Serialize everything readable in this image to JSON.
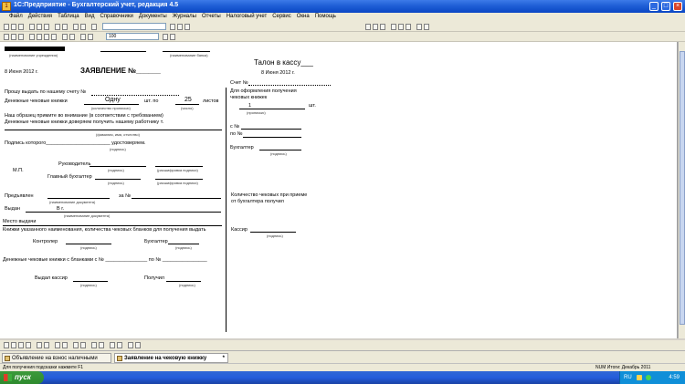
{
  "window": {
    "title": "1С:Предприятие - Бухгалтерский учет, редакция 4.5"
  },
  "menu": [
    "Файл",
    "Действия",
    "Таблица",
    "Вид",
    "Справочники",
    "Документы",
    "Журналы",
    "Отчеты",
    "Налоговый учет",
    "Сервис",
    "Окна",
    "Помощь"
  ],
  "toolbar": {
    "zoom_value": "100"
  },
  "form": {
    "bank_caption": "(наименование учреждения)",
    "bank_caption2": "(наименование банка)",
    "date": "8 Июня 2012 г.",
    "title": "ЗАЯВЛЕНИЕ №______",
    "line1": "Прошу выдать по нашему счету №",
    "line2_label": "Денежные чековые книжки",
    "line2_count": "Одну",
    "line2_unit": "шт. по",
    "line2_sheets": "25",
    "line2_end": "листов",
    "cap_count": "(количество прописью)",
    "cap_sheets": "(число)",
    "line3": "Наш образец примите во внимание (в соответствии с требованием)",
    "line4": "Денежные чековые книжки доверяем получить нашему работнику т.",
    "cap_name": "(фамилия, имя, отчество)",
    "line5": "Подпись которого_______________________ удостоверяем.",
    "cap_sign": "(подпись)",
    "mp": "М.П.",
    "head": "Руководитель",
    "chief_acc": "Главный бухгалтер",
    "cap_sign2": "(подпись)",
    "cap_decode": "(расшифровка подписи)",
    "presented": "Предъявлен",
    "cap_doc": "(наименование документа)",
    "doc_num": "за №",
    "issued": "Выдан",
    "issued_year": "В г.",
    "cap_issuer": "(наименование документа)",
    "residence": "Место выдачи",
    "note": "Книжки указанного наименования, количества чековых бланков для получения выдать",
    "controller": "Контролер",
    "accountant": "Бухгалтер",
    "cheque_books": "Денежные чековые книжки с бланками с № _______________ по № ________________",
    "cashier": "Выдал кассир",
    "received": "Получил",
    "cap_sign3": "(подпись)"
  },
  "stub": {
    "title": "Талон в кассу___",
    "date": "8 Июня 2012 г.",
    "account": "Счет №",
    "purpose": "Для оформления получения",
    "books": "чековых книжек",
    "count": "1",
    "unit": "шт.",
    "cap_count": "(прописью)",
    "from": "с №",
    "to": "по №",
    "accountant": "Бухгалтер",
    "cap_sign": "(подпись)",
    "received_count": "Количество чековых при приеме",
    "from_acc": "от бухгалтера получил",
    "cashier": "Кассир",
    "cap_sign2": "(подпись)"
  },
  "tabs": [
    {
      "label": "Объявление на взнос наличными"
    },
    {
      "label": "Заявление на чековую книжку",
      "marker": "*"
    }
  ],
  "status": {
    "hint": "Для получения подсказки нажмите F1",
    "right": "NUM Итоги: Декабрь 2011"
  },
  "taskbar": {
    "start": "пуск",
    "tray_lang": "RU",
    "time": "4:59"
  }
}
